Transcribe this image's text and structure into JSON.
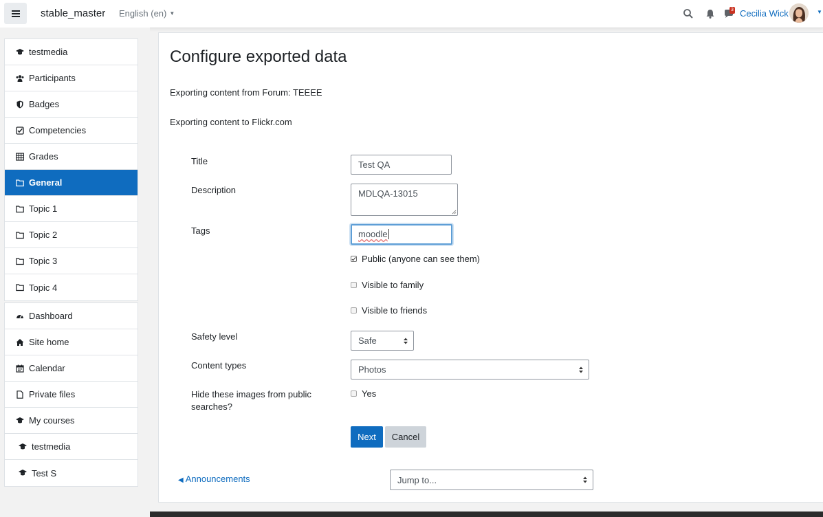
{
  "navbar": {
    "site_name": "stable_master",
    "language": "English (en)",
    "notification_count": "3",
    "user_name": "Cecilia Wick"
  },
  "sidebar": {
    "course_items": [
      {
        "label": "testmedia",
        "icon": "graduation-cap-icon"
      },
      {
        "label": "Participants",
        "icon": "users-icon"
      },
      {
        "label": "Badges",
        "icon": "shield-icon"
      },
      {
        "label": "Competencies",
        "icon": "check-square-icon"
      },
      {
        "label": "Grades",
        "icon": "table-icon"
      },
      {
        "label": "General",
        "icon": "folder-icon",
        "active": true
      },
      {
        "label": "Topic 1",
        "icon": "folder-icon"
      },
      {
        "label": "Topic 2",
        "icon": "folder-icon"
      },
      {
        "label": "Topic 3",
        "icon": "folder-icon"
      },
      {
        "label": "Topic 4",
        "icon": "folder-icon"
      }
    ],
    "site_items": [
      {
        "label": "Dashboard",
        "icon": "dashboard-icon"
      },
      {
        "label": "Site home",
        "icon": "home-icon"
      },
      {
        "label": "Calendar",
        "icon": "calendar-icon"
      },
      {
        "label": "Private files",
        "icon": "file-icon"
      },
      {
        "label": "My courses",
        "icon": "graduation-cap-icon"
      },
      {
        "label": "testmedia",
        "icon": "graduation-cap-icon"
      },
      {
        "label": "Test S",
        "icon": "graduation-cap-icon"
      }
    ]
  },
  "main": {
    "title": "Configure exported data",
    "exporting_from": "Exporting content from Forum: TEEEE",
    "exporting_to": "Exporting content to Flickr.com",
    "form": {
      "title_label": "Title",
      "title_value": "Test QA",
      "description_label": "Description",
      "description_value": "MDLQA-13015",
      "tags_label": "Tags",
      "tags_value": "moodle",
      "public_label": "Public (anyone can see them)",
      "public_checked": true,
      "family_label": "Visible to family",
      "friends_label": "Visible to friends",
      "safety_label": "Safety level",
      "safety_value": "Safe",
      "content_types_label": "Content types",
      "content_types_value": "Photos",
      "hide_label": "Hide these images from public searches?",
      "hide_option_label": "Yes"
    },
    "buttons": {
      "next": "Next",
      "cancel": "Cancel"
    },
    "prev_activity": "Announcements",
    "jump_to": "Jump to..."
  },
  "colors": {
    "primary": "#0f6cbf",
    "secondary": "#ced4da",
    "badge": "#ca3120"
  }
}
